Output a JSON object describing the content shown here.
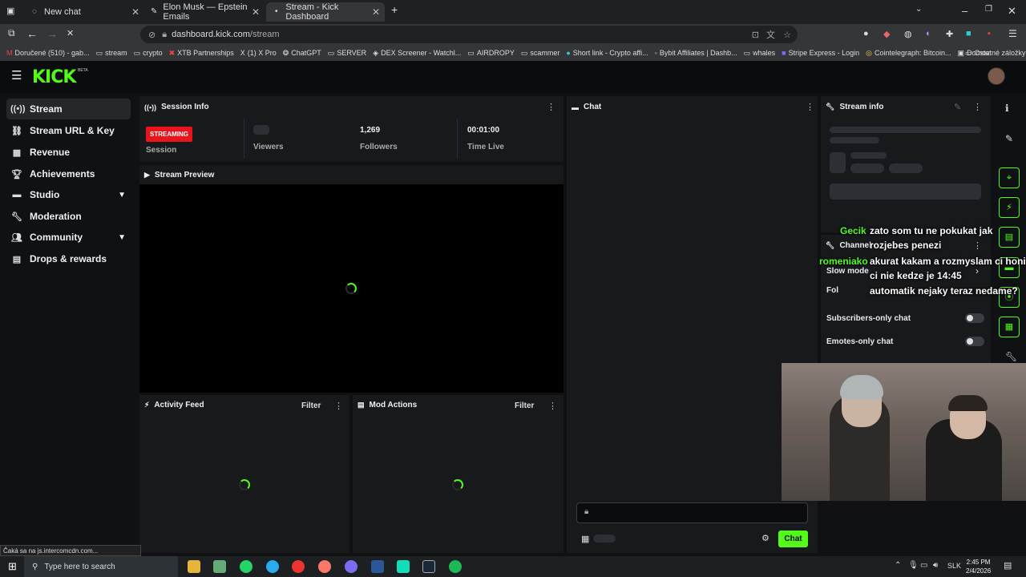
{
  "browser": {
    "tabs": [
      {
        "title": "New chat",
        "icon": "chat-icon"
      },
      {
        "title": "Elon Musk — Epstein Emails",
        "icon": "document-icon"
      },
      {
        "title": "Stream - Kick Dashboard",
        "icon": "kick-icon",
        "active": true
      }
    ],
    "url_host": "dashboard.kick.com",
    "url_path": "/stream",
    "bookmarks": [
      "Doručené (510) - gab...",
      "stream",
      "crypto",
      "XTB Partnerships",
      "(1) X Pro",
      "ChatGPT",
      "SERVER",
      "DEX Screener - Watchl...",
      "AIRDROPY",
      "scammer",
      "Short link - Crypto affi...",
      "Bybit Affiliates | Dashb...",
      "whales",
      "Stripe Express - Login",
      "Cointelegraph: Bitcoin...",
      "Domov"
    ],
    "other_bookmarks": "Ostatné záložky"
  },
  "header": {
    "logo": "KICK",
    "beta": "BETA"
  },
  "sidebar": {
    "items": [
      {
        "label": "Stream",
        "icon": "broadcast-icon"
      },
      {
        "label": "Stream URL & Key",
        "icon": "link-icon"
      },
      {
        "label": "Revenue",
        "icon": "chart-icon"
      },
      {
        "label": "Achievements",
        "icon": "trophy-icon"
      },
      {
        "label": "Studio",
        "icon": "studio-icon"
      },
      {
        "label": "Moderation",
        "icon": "wrench-icon"
      },
      {
        "label": "Community",
        "icon": "people-icon"
      },
      {
        "label": "Drops & rewards",
        "icon": "gift-icon"
      }
    ]
  },
  "session": {
    "title": "Session Info",
    "status": "STREAMING",
    "status_label": "Session",
    "viewers_label": "Viewers",
    "followers_value": "1,269",
    "followers_label": "Followers",
    "time_value": "00:01:00",
    "time_label": "Time Live"
  },
  "preview": {
    "title": "Stream Preview"
  },
  "activity": {
    "title": "Activity Feed",
    "filter": "Filter"
  },
  "modactions": {
    "title": "Mod Actions",
    "filter": "Filter"
  },
  "chat": {
    "title": "Chat",
    "send": "Chat"
  },
  "streaminfo": {
    "title": "Stream info"
  },
  "channel": {
    "title": "Channel",
    "slow_mode": "Slow mode",
    "followers": "Fol",
    "subscribers_only": "Subscribers-only chat",
    "emotes_only": "Emotes-only chat"
  },
  "overlay_chat": [
    {
      "name": "Gecik",
      "lines": [
        "zato som tu ne pokukat jak",
        "rozjebes penezi"
      ]
    },
    {
      "name": "romeniako",
      "lines": [
        "akurat kakam a rozmyslam ci honit",
        "ci nie kedze je 14:45"
      ]
    },
    {
      "lines": [
        "automatik nejaky teraz nedame?"
      ]
    }
  ],
  "statusbar": "Čaká sa na js.intercomcdn.com...",
  "taskbar": {
    "search": "Type here to search",
    "lang": "SLK",
    "time": "2:45 PM",
    "date": "2/4/2026"
  },
  "colors": {
    "accent": "#53fc18",
    "streaming": "#e8161c",
    "panel": "#17191c"
  }
}
